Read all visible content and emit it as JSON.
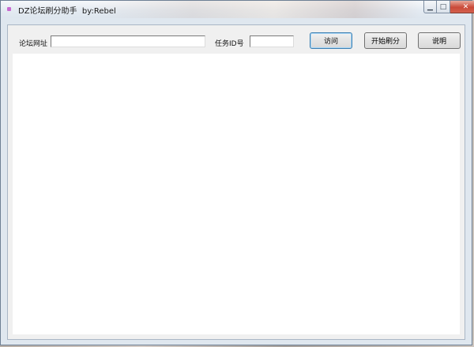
{
  "window": {
    "title": "DZ论坛刷分助手  by:Rebel",
    "controls": {
      "minimize_glyph": "▁",
      "maximize_glyph": "□",
      "close_glyph": "✕"
    }
  },
  "form": {
    "url_label": "论坛网址",
    "url_value": "",
    "task_id_label": "任务ID号",
    "task_id_value": ""
  },
  "buttons": {
    "visit": "访问",
    "start": "开始刷分",
    "help": "说明"
  },
  "icons": {
    "app": "app-icon"
  },
  "colors": {
    "app_icon": "#c86ad0",
    "close_button": "#c94a3a",
    "default_button_border": "#3c7fb1"
  }
}
